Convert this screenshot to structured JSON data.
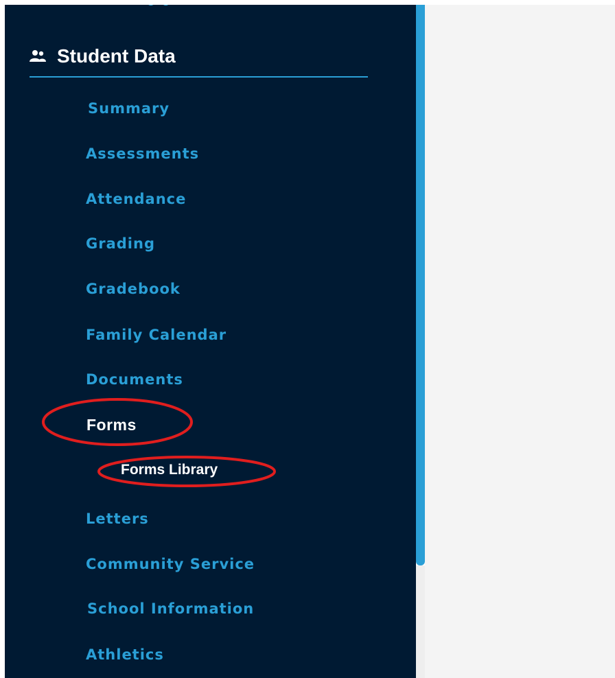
{
  "sidebar": {
    "section": {
      "title": "Student Data",
      "icon": "users-icon"
    },
    "items": [
      {
        "label": "Summary"
      },
      {
        "label": "Assessments"
      },
      {
        "label": "Attendance"
      },
      {
        "label": "Grading"
      },
      {
        "label": "Gradebook"
      },
      {
        "label": "Family Calendar"
      },
      {
        "label": "Documents"
      },
      {
        "label": "Forms",
        "active": true
      },
      {
        "label": "Letters"
      },
      {
        "label": "Community Service"
      },
      {
        "label": "School Information"
      },
      {
        "label": "Athletics"
      }
    ],
    "sub_items": [
      {
        "label": "Forms Library"
      }
    ]
  },
  "colors": {
    "sidebar_bg": "#001a33",
    "accent": "#2a9fd6",
    "annotation": "#e01e1e",
    "content_bg": "#f4f4f4"
  }
}
